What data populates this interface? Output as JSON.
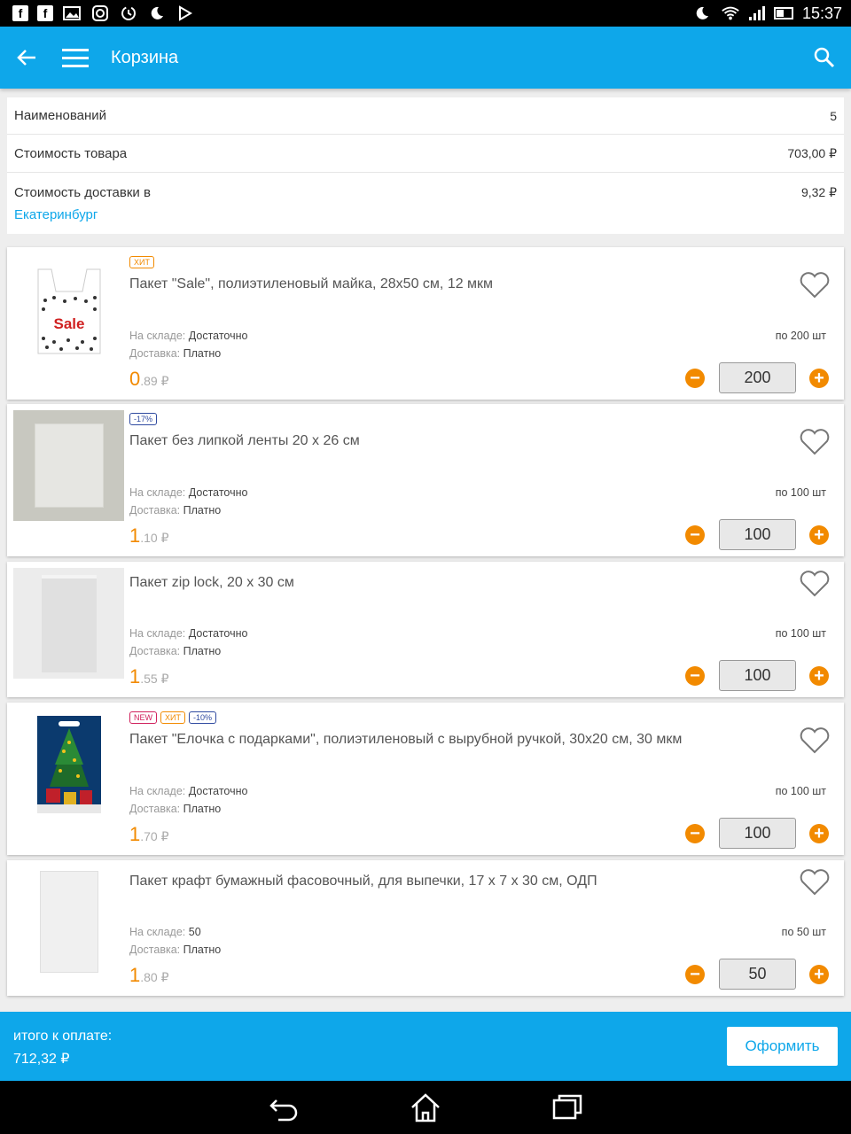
{
  "status_bar": {
    "time": "15:37",
    "left_icons": [
      "facebook-icon",
      "facebook-icon",
      "gallery-icon",
      "instagram-icon",
      "sync-icon",
      "moon-icon",
      "play-store-icon"
    ],
    "right_icons": [
      "moon-icon",
      "wifi-icon",
      "signal-icon",
      "battery-icon"
    ]
  },
  "app_bar": {
    "title": "Корзина",
    "icons": [
      "back-arrow-icon",
      "menu-icon",
      "search-icon"
    ]
  },
  "summary": {
    "items_label": "Наименований",
    "items_value": "5",
    "goods_cost_label": "Стоимость товара",
    "goods_cost_value": "703,00 ₽",
    "delivery_label": "Стоимость доставки в",
    "delivery_city": "Екатеринбург",
    "delivery_value": "9,32 ₽"
  },
  "labels": {
    "stock": "На складе:",
    "delivery": "Доставка:"
  },
  "products": [
    {
      "badges": [
        {
          "text": "ХИТ",
          "type": "hit"
        }
      ],
      "name": "Пакет \"Sale\", полиэтиленовый майка, 28х50 см, 12 мкм",
      "stock": "Достаточно",
      "delivery": "Платно",
      "per_unit": "по 200 шт",
      "price_int": "0",
      "price_frac": ".89 ₽",
      "qty": "200",
      "thumb_text": "Sale"
    },
    {
      "badges": [
        {
          "text": "-17%",
          "type": "disc"
        }
      ],
      "name": "Пакет без липкой ленты 20 х 26 см",
      "stock": "Достаточно",
      "delivery": "Платно",
      "per_unit": "по 100 шт",
      "price_int": "1",
      "price_frac": ".10 ₽",
      "qty": "100"
    },
    {
      "badges": [],
      "name": "Пакет zip lock, 20 х 30 см",
      "stock": "Достаточно",
      "delivery": "Платно",
      "per_unit": "по 100 шт",
      "price_int": "1",
      "price_frac": ".55 ₽",
      "qty": "100"
    },
    {
      "badges": [
        {
          "text": "NEW",
          "type": "new"
        },
        {
          "text": "ХИТ",
          "type": "hit"
        },
        {
          "text": "-10%",
          "type": "disc"
        }
      ],
      "name": "Пакет \"Елочка с подарками\", полиэтиленовый с вырубной ручкой, 30х20 см, 30 мкм",
      "stock": "Достаточно",
      "delivery": "Платно",
      "per_unit": "по 100 шт",
      "price_int": "1",
      "price_frac": ".70 ₽",
      "qty": "100"
    },
    {
      "badges": [],
      "name": "Пакет крафт бумажный фасовочный, для выпечки, 17 х 7 х 30 см, ОДП",
      "stock": "50",
      "delivery": "Платно",
      "per_unit": "по 50 шт",
      "price_int": "1",
      "price_frac": ".80 ₽",
      "qty": "50"
    }
  ],
  "checkout": {
    "total_label": "итого к оплате:",
    "total_value": "712,32 ₽",
    "button_label": "Оформить"
  },
  "nav_bar": {
    "icons": [
      "back-icon",
      "home-icon",
      "recent-apps-icon"
    ]
  },
  "colors": {
    "primary": "#0ea7ea",
    "accent": "#f28a00",
    "new_badge": "#d0205c",
    "discount_badge": "#2f4aa0"
  }
}
